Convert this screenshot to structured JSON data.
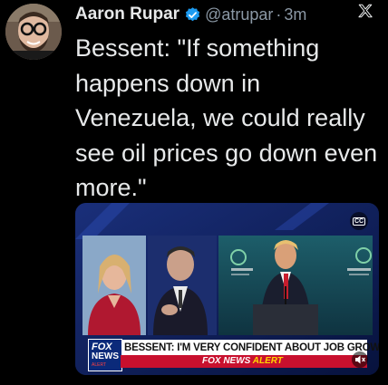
{
  "tweet": {
    "author_name": "Aaron Rupar",
    "handle": "@atrupar",
    "separator": "·",
    "time": "3m",
    "text": "Bessent: \"If something happens down in Venezuela, we could really see oil prices go down even more.\""
  },
  "media": {
    "chyron": "BESSENT: I'M VERY CONFIDENT ABOUT JOB GROWTH",
    "network_logo_top": "FOX",
    "network_logo_bottom": "NEWS",
    "network_logo_sub": "ALERT",
    "alert_brand": "FOX NEWS",
    "alert_word": "ALERT",
    "cc_label": "CC"
  },
  "icons": {
    "verified": "verified-badge-icon",
    "platform": "x-logo-icon",
    "captions": "closed-captions-icon",
    "mute": "speaker-muted-icon"
  },
  "colors": {
    "background": "#000000",
    "text": "#e7e9ea",
    "secondary_text": "#8b98a5",
    "verified": "#1d9bf0",
    "fox_blue": "#0b2a7a",
    "alert_red": "#c8102e"
  }
}
